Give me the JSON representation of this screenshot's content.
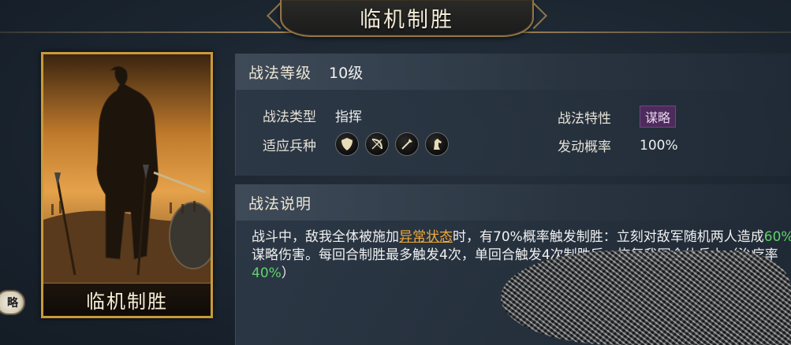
{
  "title": "临机制胜",
  "card": {
    "name": "临机制胜"
  },
  "side_badge": {
    "label": "略"
  },
  "level": {
    "label": "战法等级",
    "value": "10级"
  },
  "attributes": {
    "type_label": "战法类型",
    "type_value": "指挥",
    "feature_label": "战法特性",
    "feature_value": "谋略",
    "troop_label": "适应兵种",
    "troop_icons": [
      "shield-icon",
      "bow-icon",
      "spear-icon",
      "horse-icon"
    ],
    "chance_label": "发动概率",
    "chance_value": "100%"
  },
  "description": {
    "header": "战法说明",
    "p1": "战斗中，敌我全体被施加",
    "status_link": "异常状态",
    "p2": "时，有70%概率触发制胜：立刻对敌军随机两人造成",
    "dmg_pct": "60%",
    "p3": "谋略伤害。每回合制胜最多触发4次，单回合触发4次制胜后，恢复我军全体兵力（治疗率",
    "heal_pct": "40%",
    "p4": "）"
  },
  "colors": {
    "gold_border": "#c99a3a",
    "status_orange": "#f0a93a",
    "percent_green": "#5fd36a",
    "tag_purple": "#4d2c5c"
  }
}
